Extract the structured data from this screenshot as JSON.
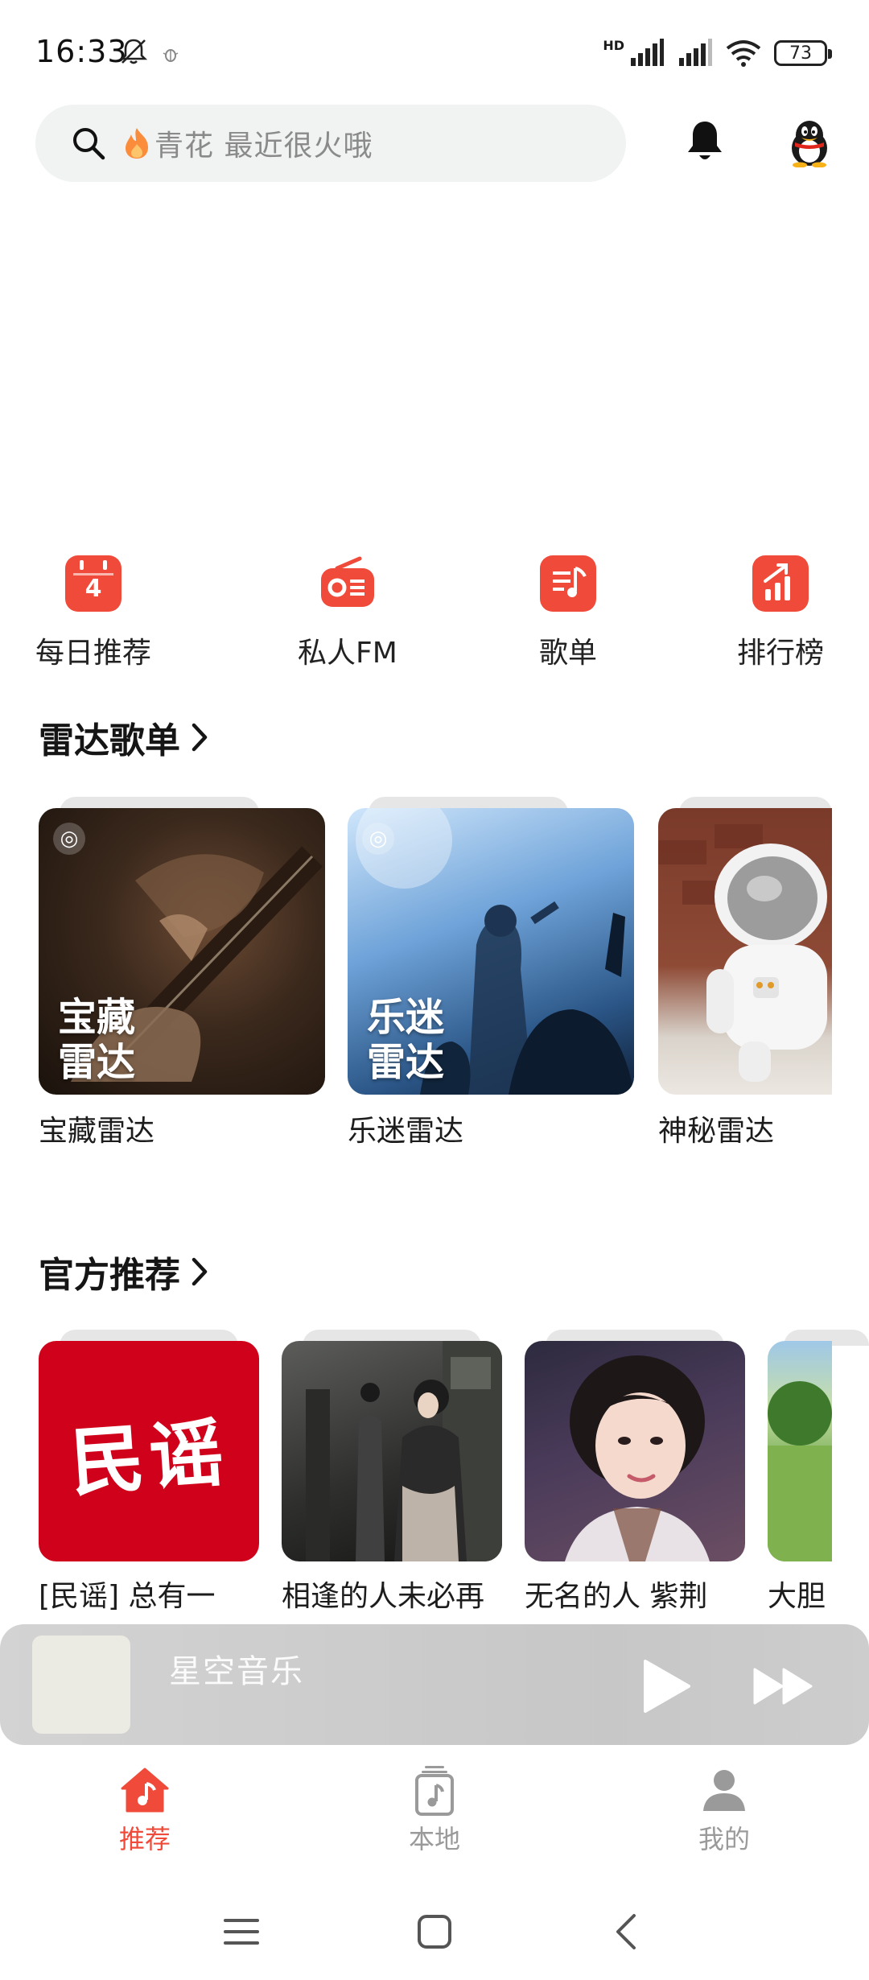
{
  "status_bar": {
    "time": "16:33",
    "battery": "73",
    "hd_label": "HD"
  },
  "header": {
    "search_placeholder": "青花 最近很火哦"
  },
  "quick_nav": [
    {
      "label": "每日推荐",
      "icon": "calendar-icon",
      "badge": "4"
    },
    {
      "label": "私人FM",
      "icon": "radio-icon"
    },
    {
      "label": "歌单",
      "icon": "playlist-icon"
    },
    {
      "label": "排行榜",
      "icon": "chart-icon"
    }
  ],
  "radar_section": {
    "title": "雷达歌单",
    "cards": [
      {
        "cover_line1": "宝藏",
        "cover_line2": "雷达",
        "caption": "宝藏雷达"
      },
      {
        "cover_line1": "乐迷",
        "cover_line2": "雷达",
        "caption": "乐迷雷达"
      },
      {
        "cover_line1": "",
        "cover_line2": "",
        "caption": "神秘雷达"
      }
    ]
  },
  "official_section": {
    "title": "官方推荐",
    "cards": [
      {
        "cover_text": "民谣",
        "caption": "[民谣] 总有一"
      },
      {
        "caption": "相逢的人未必再"
      },
      {
        "caption": "无名的人 紫荆"
      },
      {
        "caption": "大胆"
      }
    ]
  },
  "mini_player": {
    "title": "星空音乐"
  },
  "tabs": [
    {
      "label": "推荐",
      "active": true
    },
    {
      "label": "本地",
      "active": false
    },
    {
      "label": "我的",
      "active": false
    }
  ],
  "colors": {
    "accent": "#f04b3a",
    "tab_inactive": "#9a9a9a"
  }
}
